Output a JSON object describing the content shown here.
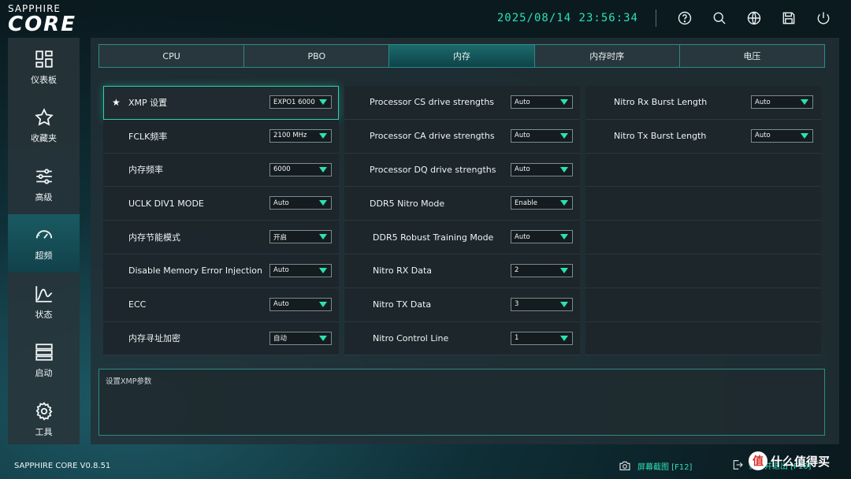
{
  "app": {
    "logo_top": "SAPPHIRE",
    "logo_main": "CORE",
    "datetime": "2025/08/14 23:56:34",
    "version": "SAPPHIRE CORE V0.8.51"
  },
  "top_icons": [
    "help-icon",
    "search-icon",
    "globe-icon",
    "save-icon",
    "power-icon"
  ],
  "sidebar": {
    "items": [
      {
        "label": "仪表板",
        "icon": "dashboard-icon"
      },
      {
        "label": "收藏夹",
        "icon": "star-icon"
      },
      {
        "label": "高级",
        "icon": "sliders-icon"
      },
      {
        "label": "超频",
        "icon": "gauge-icon",
        "active": true
      },
      {
        "label": "状态",
        "icon": "chart-icon"
      },
      {
        "label": "启动",
        "icon": "boot-list-icon"
      },
      {
        "label": "工具",
        "icon": "gear-icon"
      }
    ]
  },
  "tabs": [
    {
      "label": "CPU"
    },
    {
      "label": "PBO"
    },
    {
      "label": "内存",
      "active": true
    },
    {
      "label": "内存时序"
    },
    {
      "label": "电压"
    }
  ],
  "columns": {
    "col1": [
      {
        "label": "XMP 设置",
        "value": "EXPO1 6000",
        "starred": true,
        "selected": true
      },
      {
        "label": "FCLK频率",
        "value": "2100 MHz"
      },
      {
        "label": "内存频率",
        "value": "6000"
      },
      {
        "label": "UCLK DIV1 MODE",
        "value": "Auto"
      },
      {
        "label": "内存节能模式",
        "value": "开启"
      },
      {
        "label": "Disable Memory Error Injection",
        "value": "Auto"
      },
      {
        "label": "ECC",
        "value": "Auto"
      },
      {
        "label": "内存寻址加密",
        "value": "自动"
      }
    ],
    "col2": [
      {
        "label": "Processor CS drive strengths",
        "value": "Auto"
      },
      {
        "label": "Processor CA drive strengths",
        "value": "Auto"
      },
      {
        "label": "Processor DQ drive strengths",
        "value": "Auto"
      },
      {
        "label": "DDR5 Nitro Mode",
        "value": "Enable"
      },
      {
        "label": "DDR5 Robust Training Mode",
        "value": "Auto"
      },
      {
        "label": "Nitro RX Data",
        "value": "2"
      },
      {
        "label": "Nitro TX Data",
        "value": "3"
      },
      {
        "label": "Nitro Control Line",
        "value": "1"
      }
    ],
    "col3": [
      {
        "label": "Nitro Rx Burst Length",
        "value": "Auto"
      },
      {
        "label": "Nitro Tx Burst Length",
        "value": "Auto"
      },
      {
        "label": "",
        "value": ""
      },
      {
        "label": "",
        "value": ""
      },
      {
        "label": "",
        "value": ""
      },
      {
        "label": "",
        "value": ""
      },
      {
        "label": "",
        "value": ""
      },
      {
        "label": "",
        "value": ""
      }
    ]
  },
  "description": "设置XMP参数",
  "footer": {
    "screenshot_label": "屏幕截图 [F12]",
    "exit_label": "保存并退出 [F10]",
    "watermark_logo": "值",
    "watermark_text": "什么值得买"
  },
  "colors": {
    "accent": "#2de0b8",
    "active_tab": "#1c6a6c",
    "panel": "#22303a"
  }
}
